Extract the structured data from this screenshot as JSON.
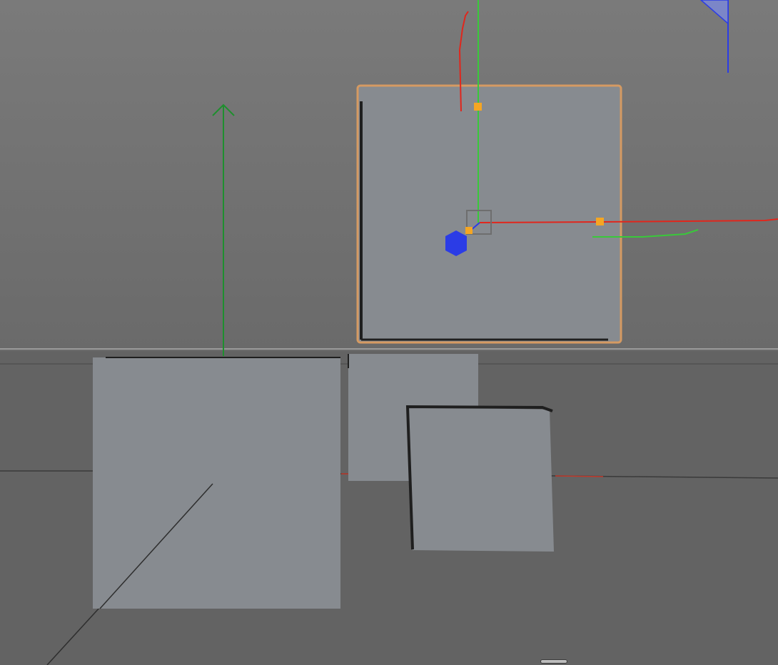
{
  "viewport": {
    "background_top": "#7a7a7a",
    "background_bottom": "#5c5c5c",
    "floor_color": "#636363",
    "horizon_color": "#9a9a9a",
    "selection_outline_color": "#d59a62",
    "cube_face_color": "#878b90",
    "cube_edge_color": "#1f1f1f",
    "axis_x_color": "#e1261c",
    "axis_y_color": "#39c93a",
    "axis_z_color": "#2b3ce6",
    "handle_color": "#f5a623",
    "light_color": "#2b3ce6"
  }
}
